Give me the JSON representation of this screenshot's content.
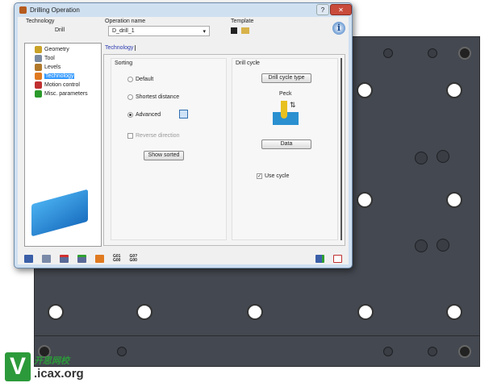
{
  "dialog": {
    "title": "Drilling Operation",
    "help": "?",
    "close": "✕",
    "technology_label": "Technology",
    "technology_value": "Drill",
    "operation_name_label": "Operation name",
    "operation_name_value": "D_drill_1",
    "template_label": "Template",
    "tree": [
      {
        "label": "Geometry",
        "color": "#c9a227"
      },
      {
        "label": "Tool",
        "color": "#7a8aa0"
      },
      {
        "label": "Levels",
        "color": "#b0782a"
      },
      {
        "label": "Technology",
        "color": "#e07a20"
      },
      {
        "label": "Motion control",
        "color": "#c03030"
      },
      {
        "label": "Misc. parameters",
        "color": "#2a9a2a"
      }
    ],
    "tab": "Technology",
    "sorting": {
      "title": "Sorting",
      "options": [
        "Default",
        "Shortest distance",
        "Advanced"
      ],
      "selected": "Advanced",
      "reverse_direction": "Reverse direction",
      "show_sorted": "Show sorted"
    },
    "drill_cycle": {
      "title": "Drill cycle",
      "type_button": "Drill cycle type",
      "cycle_name": "Peck",
      "data_button": "Data",
      "use_cycle": "Use cycle",
      "use_cycle_checked": true
    },
    "toolbar": {
      "gcode1": "G01\nG00",
      "gcode2": "G0?\nG00"
    }
  },
  "watermark": {
    "letter": "V",
    "cn": "开思网校",
    "site": ".icax.org"
  },
  "colors": {
    "plate": "#444850",
    "accent": "#3399ff"
  }
}
